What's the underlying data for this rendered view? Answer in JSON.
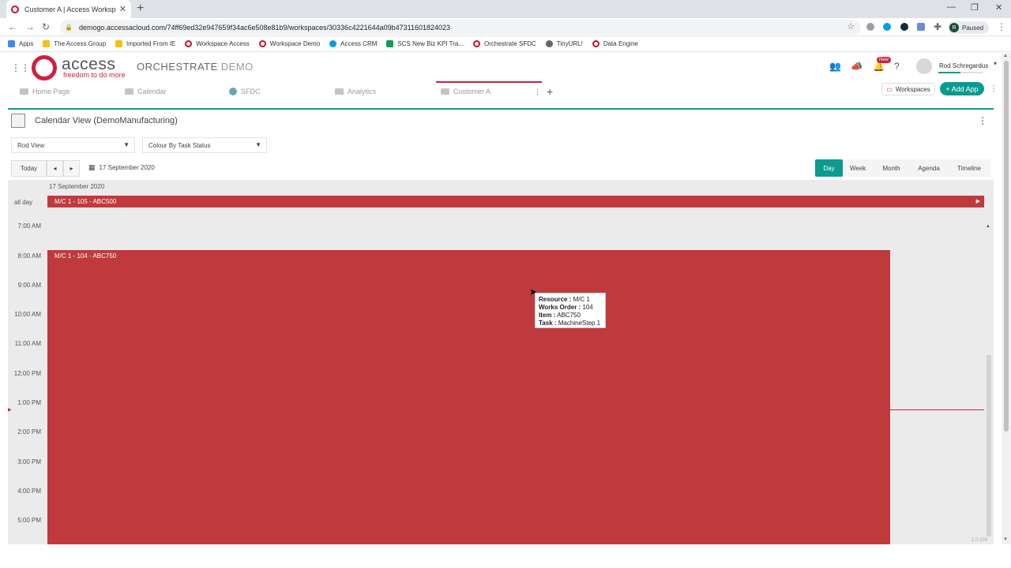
{
  "browser": {
    "tab_title": "Customer A | Access Workspace",
    "url": "demogo.accessacloud.com/74ff69ed32e947659f34ac6e508e81b9/workspaces/30336c4221644a09b473116018240​23",
    "profile_initial": "R",
    "profile_status": "Paused",
    "bookmarks": [
      {
        "label": "Apps",
        "color": "#4285f4"
      },
      {
        "label": "The Access Group",
        "color": "#f4c20d"
      },
      {
        "label": "Imported From IE",
        "color": "#f4c20d"
      },
      {
        "label": "Workspace Access",
        "color": "#c8102e"
      },
      {
        "label": "Workspace Demo",
        "color": "#c8102e"
      },
      {
        "label": "Access CRM",
        "color": "#00a1e0"
      },
      {
        "label": "SCS New Biz KPI Tra...",
        "color": "#0f9d58"
      },
      {
        "label": "Orchestrate SFDC",
        "color": "#c8102e"
      },
      {
        "label": "TinyURL!",
        "color": "#666666"
      },
      {
        "label": "Data Engine",
        "color": "#c8102e"
      }
    ]
  },
  "app": {
    "logo_word": "access",
    "logo_tag": "freedom to do more",
    "product": "ORCHESTRATE",
    "env": "DEMO",
    "new_badge": "New",
    "user_name": "Rod Schregardus",
    "accent": "#0a9b8f",
    "brand": "#d01f3c"
  },
  "workspace": {
    "tabs": [
      {
        "label": "Home Page"
      },
      {
        "label": "Calendar"
      },
      {
        "label": "SFDC"
      },
      {
        "label": "Analytics"
      },
      {
        "label": "Customer A"
      }
    ],
    "workspaces_btn": "Workspaces",
    "add_app_btn": "+ Add App"
  },
  "panel": {
    "title": "Calendar View (DemoManufacturing)",
    "view_select": "Rod View",
    "colour_select": "Colour By Task Status",
    "today_btn": "Today",
    "date": "17 September 2020",
    "views": [
      "Day",
      "Week",
      "Month",
      "Agenda",
      "Timeline"
    ],
    "active_view": "Day"
  },
  "calendar": {
    "day_header": "17 September 2020",
    "allday_label": "all day",
    "allday_event": "M/C 1 - 105 - ABC500",
    "times": [
      "7:00 AM",
      "8:00 AM",
      "9:00 AM",
      "10:00 AM",
      "11:00 AM",
      "12:00 PM",
      "1:00 PM",
      "2:00 PM",
      "3:00 PM",
      "4:00 PM",
      "5:00 PM"
    ],
    "timed_event": "M/C 1 - 104 - ABC750",
    "event_color": "#c03a3d",
    "version": "2.0.228"
  },
  "tooltip": {
    "resource_label": "Resource :",
    "resource_value": "M/C 1",
    "works_order_label": "Works Order :",
    "works_order_value": "104",
    "item_label": "Item :",
    "item_value": "ABC750",
    "task_label": "Task :",
    "task_value": "MachineStep 1"
  }
}
